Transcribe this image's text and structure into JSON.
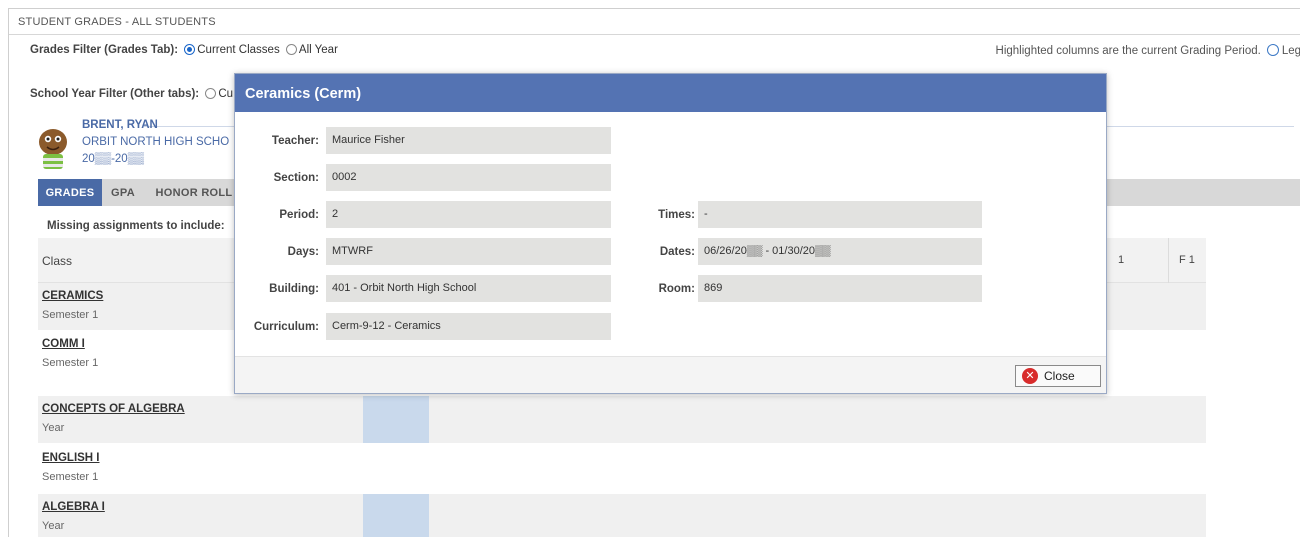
{
  "page": {
    "title": "STUDENT GRADES - ALL STUDENTS"
  },
  "filters": {
    "grades_label": "Grades Filter (Grades Tab):",
    "grades_options": [
      "Current Classes",
      "All Year"
    ],
    "grades_selected": "Current Classes",
    "school_year_label": "School Year Filter (Other tabs):",
    "school_year_partial_option": "Cu",
    "highlight_note": "Highlighted columns are the current Grading Period.",
    "legend_label": "Leg"
  },
  "student": {
    "name": "BRENT, RYAN",
    "school": "ORBIT NORTH HIGH SCHO",
    "year": "20▒▒-20▒▒"
  },
  "tabs": [
    {
      "label": "GRADES",
      "active": true
    },
    {
      "label": "GPA",
      "active": false
    },
    {
      "label": "HONOR ROLL",
      "active": false
    }
  ],
  "missing_label": "Missing assignments to include:",
  "grid": {
    "class_header": "Class",
    "column_headers": [
      "1",
      "F 1"
    ],
    "rows": [
      {
        "name": "CERAMICS",
        "term": "Semester 1"
      },
      {
        "name": "COMM I",
        "term": "Semester 1"
      },
      {
        "name": "CONCEPTS OF ALGEBRA",
        "term": "Year"
      },
      {
        "name": "ENGLISH I",
        "term": "Semester 1"
      },
      {
        "name": "ALGEBRA I",
        "term": "Year"
      }
    ]
  },
  "modal": {
    "title": "Ceramics (Cerm)",
    "teacher_label": "Teacher:",
    "teacher": "Maurice Fisher",
    "section_label": "Section:",
    "section": "0002",
    "period_label": "Period:",
    "period": "2",
    "times_label": "Times:",
    "times": "-",
    "days_label": "Days:",
    "days": "MTWRF",
    "dates_label": "Dates:",
    "dates": "06/26/20▒▒ - 01/30/20▒▒",
    "building_label": "Building:",
    "building": "401 - Orbit North High School",
    "room_label": "Room:",
    "room": "869",
    "curriculum_label": "Curriculum:",
    "curriculum": "Cerm-9-12 - Ceramics",
    "close_label": "Close"
  },
  "colors": {
    "header_blue": "#5473b3",
    "tab_active": "#4a6aa6",
    "highlight_column": "#c9d9ec",
    "close_red": "#d82c2c"
  }
}
